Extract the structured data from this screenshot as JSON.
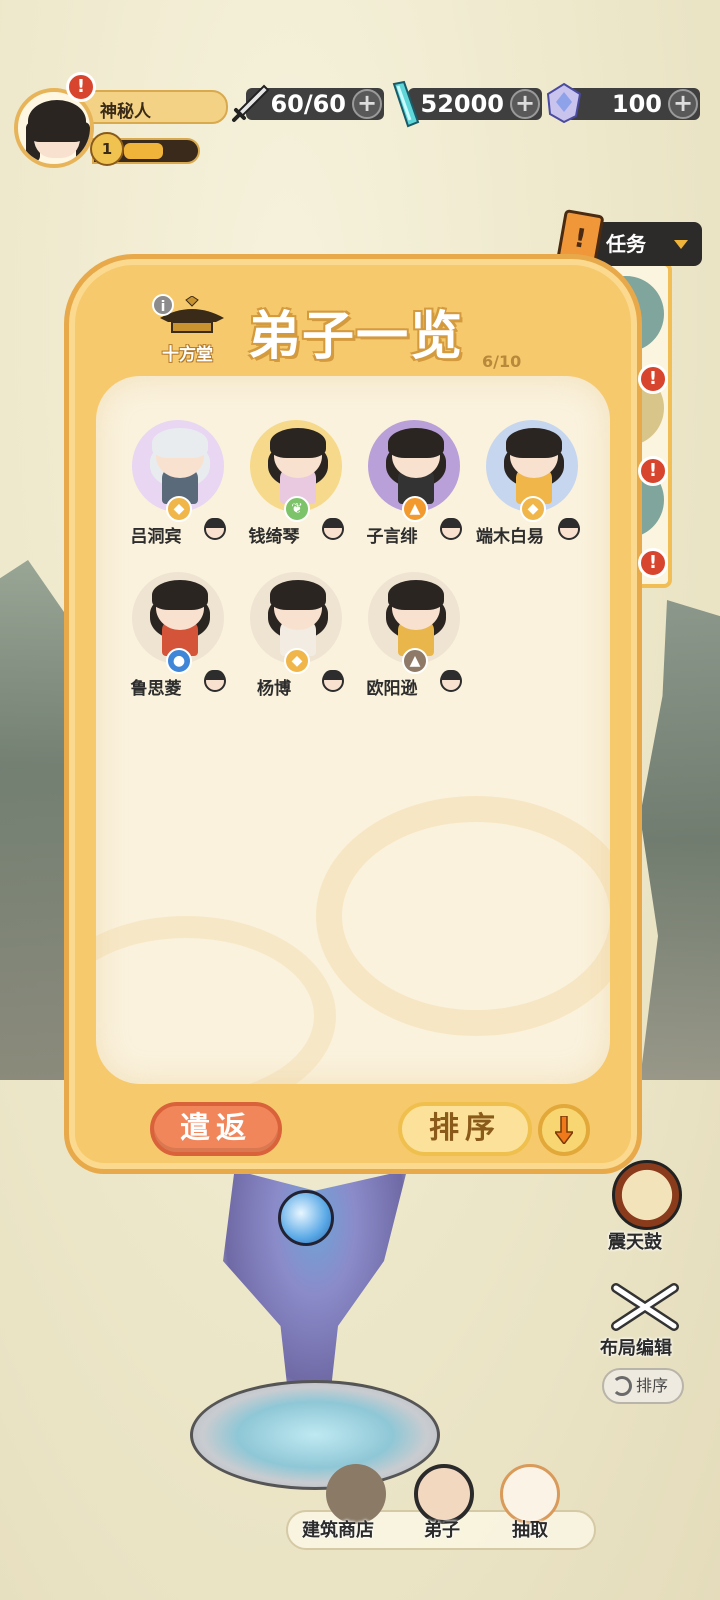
{
  "player": {
    "name": "神秘人",
    "level": "1",
    "level_progress": 0.55
  },
  "resources": {
    "stamina": "60/60",
    "jade": "52000",
    "crystal": "100"
  },
  "panel": {
    "title": "弟子一览",
    "hall_name": "十方堂",
    "count": "6/10",
    "disciples": [
      {
        "name": "吕洞宾",
        "element": "gold-element-icon",
        "color": "#f0b64a",
        "bg": "#e8d6f2"
      },
      {
        "name": "钱绮琴",
        "element": "wood-element-icon",
        "color": "#7cc36a",
        "bg": "#f6d98a"
      },
      {
        "name": "子言绯",
        "element": "fire-element-icon",
        "color": "#f39a2e",
        "bg": "#b9a0d8"
      },
      {
        "name": "端木白易",
        "element": "gold-element-icon",
        "color": "#f0b64a",
        "bg": "#c7d6ef"
      },
      {
        "name": "鲁思菱",
        "element": "water-element-icon",
        "color": "#3f86d8",
        "bg": "#efe3d1"
      },
      {
        "name": "杨博",
        "element": "gold-element-icon",
        "color": "#f0b64a",
        "bg": "#efe3d1"
      },
      {
        "name": "欧阳逊",
        "element": "earth-element-icon",
        "color": "#8f7a68",
        "bg": "#efe3d1"
      }
    ],
    "dismiss_label": "遣返",
    "sort_label": "排序"
  },
  "side": {
    "task_label": "任务",
    "drum_label": "震天鼓",
    "layout_label": "布局编辑",
    "sort_label": "排序"
  },
  "nav": {
    "shop_label": "建筑商店",
    "disciples_label": "弟子",
    "draw_label": "抽取"
  }
}
